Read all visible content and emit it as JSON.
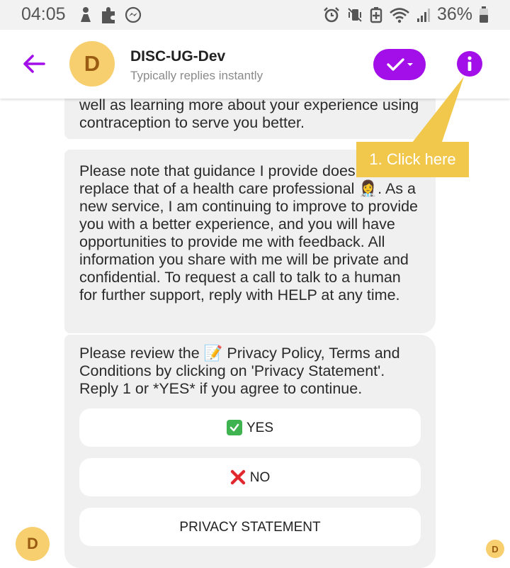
{
  "status_bar": {
    "time": "04:05",
    "battery": "36%",
    "icons": [
      "person-icon",
      "puzzle-icon",
      "messenger-icon",
      "alarm-icon",
      "vibrate-icon",
      "battery-saver-icon",
      "wifi-icon",
      "signal-icon",
      "battery-icon"
    ]
  },
  "header": {
    "avatar_letter": "D",
    "title": "DISC-UG-Dev",
    "subtitle": "Typically replies instantly",
    "icons": [
      "back-arrow-icon",
      "checkmark-icon",
      "info-icon"
    ]
  },
  "messages": {
    "partial": "well as learning more about your experience using contraception to serve you better.",
    "guidance": "Please note that guidance I provide does not replace that of a health care professional 👩‍⚕️. As a new service, I am continuing to improve to provide you with a better experience, and you will have opportunities to provide me with feedback. All information you share with me will be private and confidential.  To request a call to talk to a human for further support, reply with HELP at any time.",
    "review": "Please review the 📝 Privacy Policy, Terms and Conditions by clicking on 'Privacy Statement'. Reply 1 or *YES* if you agree to continue."
  },
  "quick_replies": {
    "yes": "YES",
    "no": "NO",
    "privacy": "PRIVACY STATEMENT"
  },
  "footer": {
    "avatar_letter": "D",
    "receipt_letter": "D"
  },
  "annotation": {
    "label": "1. Click here"
  },
  "colors": {
    "accent": "#a20fe8",
    "avatar": "#f8cf6e",
    "bubble": "#f0f0f0",
    "callout": "#f1c84b"
  }
}
